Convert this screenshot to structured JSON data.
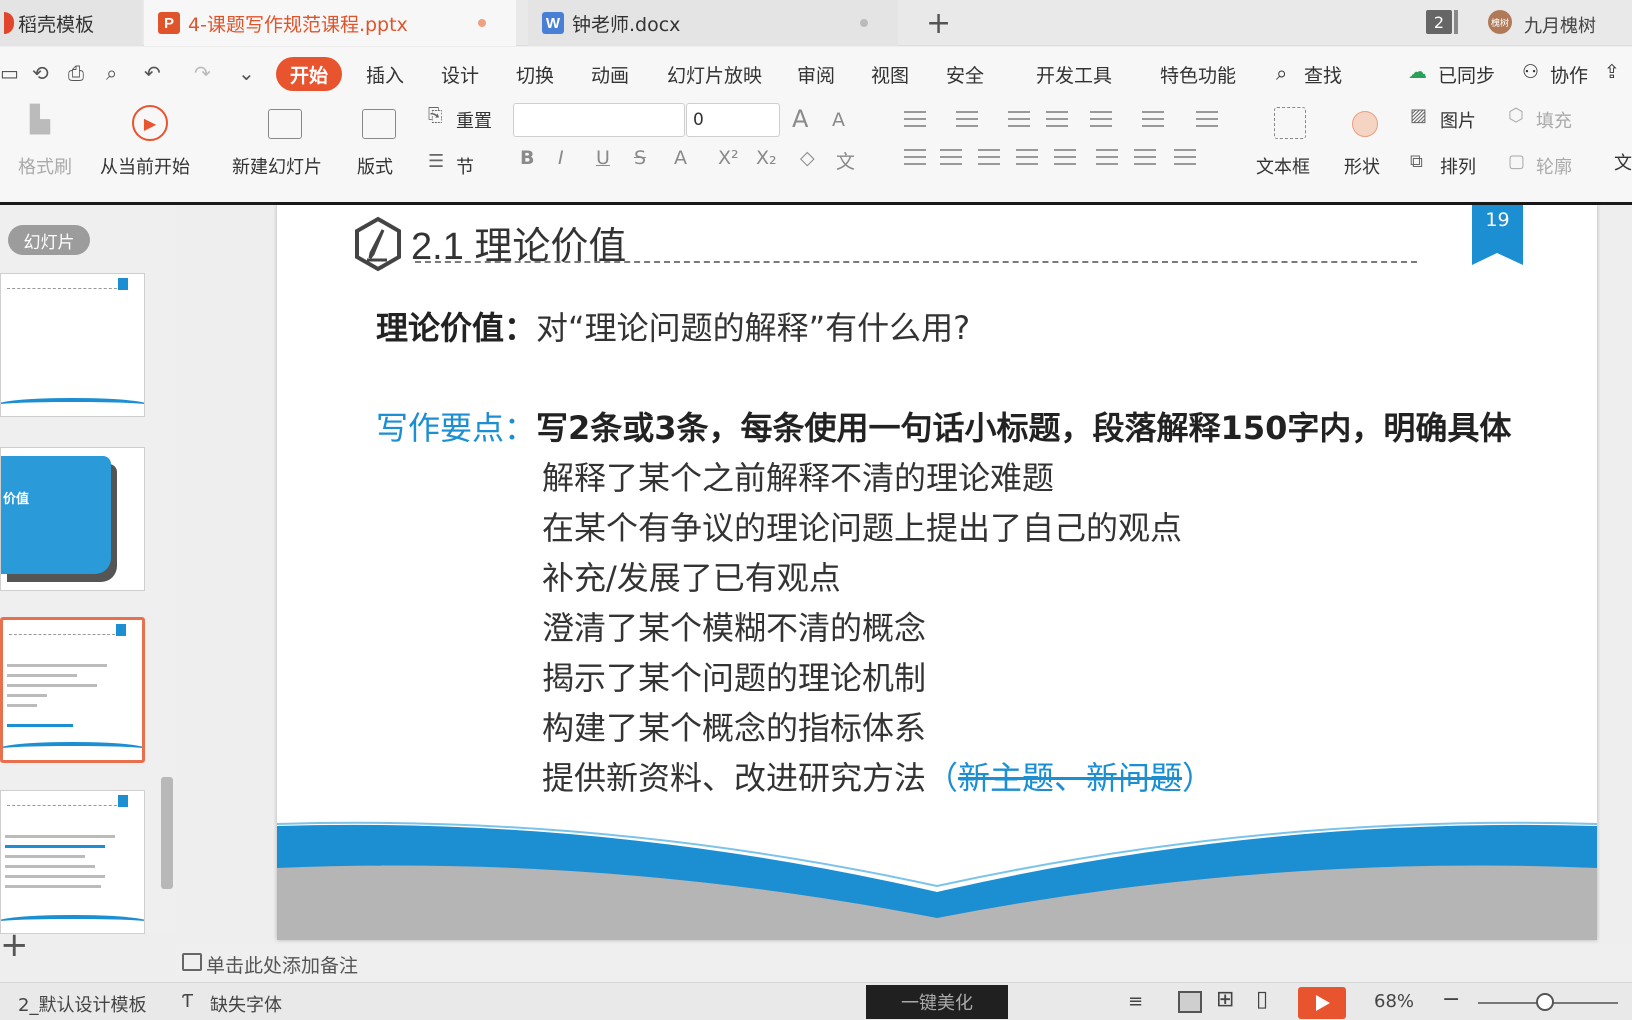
{
  "tabs": {
    "templates": "稻壳模板",
    "pptx": "4-课题写作规范课程.pptx",
    "docx": "钟老师.docx",
    "new_tab": "+",
    "window_count": "2",
    "user_avatar": "槐树",
    "user_name": "九月槐树",
    "pptx_icon_letter": "P",
    "docx_icon_letter": "W"
  },
  "menu": {
    "active": "开始",
    "items": [
      "插入",
      "设计",
      "切换",
      "动画",
      "幻灯片放映",
      "审阅",
      "视图",
      "安全",
      "开发工具",
      "特色功能",
      "查找"
    ],
    "sync": "已同步",
    "collab": "协作"
  },
  "ribbon": {
    "format_painter": "格式刷",
    "play_from_current": "从当前开始",
    "new_slide": "新建幻灯片",
    "layout": "版式",
    "reset": "重置",
    "section": "节",
    "font_name": "",
    "font_size": "0",
    "text_box": "文本框",
    "shape": "形状",
    "picture": "图片",
    "arrange": "排列",
    "fill": "填充",
    "outline": "轮廓",
    "cut_off_label": "文",
    "font_grow": "A",
    "font_shrink": "A"
  },
  "left_pane": {
    "label": "幻灯片",
    "thumb2_text": "价值"
  },
  "slide": {
    "title": "2.1 理论价值",
    "page_number": "19",
    "line1_label": "理论价值：",
    "line1_text": "对“理论问题的解释”有什么用?",
    "line2_label": "写作要点：",
    "line2_text": "写2条或3条，每条使用一句话小标题，段落解释150字内，明确具体",
    "points": [
      "解释了某个之前解释不清的理论难题",
      "在某个有争议的理论问题上提出了自己的观点",
      "补充/发展了已有观点",
      "澄清了某个模糊不清的概念",
      "揭示了某个问题的理论机制",
      "构建了某个概念的指标体系",
      "提供新资料、改进研究方法"
    ],
    "note_open": "（",
    "note_struck": "新主题、新问题",
    "note_close": "）"
  },
  "notes": {
    "placeholder": "单击此处添加备注"
  },
  "status": {
    "slide_info": "2_默认设计模板",
    "missing_font": "缺失字体",
    "beautify": "一键美化",
    "zoom": "68%"
  },
  "colors": {
    "accent_orange": "#e8542e",
    "slide_blue": "#1b8fd2"
  }
}
